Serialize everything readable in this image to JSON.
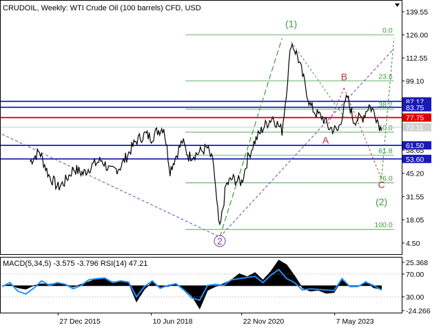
{
  "header": {
    "symbol_line": "CRUDOIL, Weekly:  WTI Crude Oil (100 barrels) CFD, USD"
  },
  "chart_data": [
    {
      "type": "line",
      "title": "CRUDOIL, Weekly:  WTI Crude Oil (100 barrels) CFD, USD",
      "price_axis": {
        "ticks": [
          "139.55",
          "126.00",
          "112.55",
          "99.10",
          "85.65",
          "72.20",
          "58.65",
          "45.20",
          "31.55",
          "18.05",
          "4.50"
        ],
        "ylim": [
          -2,
          146
        ]
      },
      "time_axis": {
        "ticks": [
          "27 Dec 2015",
          "10 Jun 2018",
          "22 Nov 2020",
          "7 May 2023"
        ]
      },
      "price_series": {
        "name": "",
        "x": [
          "2015-03",
          "2015-06",
          "2015-09",
          "2015-12",
          "2016-02",
          "2016-05",
          "2016-08",
          "2016-11",
          "2017-02",
          "2017-05",
          "2017-08",
          "2017-11",
          "2018-01",
          "2018-04",
          "2018-06",
          "2018-08",
          "2018-10",
          "2018-12",
          "2019-02",
          "2019-04",
          "2019-06",
          "2019-09",
          "2019-12",
          "2020-02",
          "2020-03",
          "2020-04",
          "2020-06",
          "2020-08",
          "2020-11",
          "2021-01",
          "2021-03",
          "2021-06",
          "2021-09",
          "2021-12",
          "2022-01",
          "2022-03",
          "2022-05",
          "2022-07",
          "2022-09",
          "2022-11",
          "2023-01",
          "2023-03",
          "2023-06",
          "2023-09",
          "2023-11",
          "2024-02",
          "2024-04",
          "2024-06",
          "2024-08"
        ],
        "values": [
          52,
          58,
          44,
          37,
          40,
          48,
          45,
          50,
          53,
          46,
          49,
          58,
          64,
          68,
          66,
          70,
          72,
          47,
          56,
          64,
          55,
          57,
          60,
          50,
          28,
          12,
          38,
          42,
          40,
          54,
          63,
          72,
          78,
          70,
          86,
          122,
          114,
          100,
          85,
          80,
          78,
          72,
          70,
          90,
          76,
          78,
          85,
          80,
          70
        ]
      },
      "horizontal_levels": [
        {
          "price": 87.17,
          "label": "87.17",
          "color": "#1a1ab4"
        },
        {
          "price": 83.75,
          "label": "83.75",
          "color": "#1a1ab4"
        },
        {
          "price": 77.75,
          "label": "77.75",
          "color": "#e00000"
        },
        {
          "price": 72.11,
          "label": "72.11",
          "color": "#c8c8c8"
        },
        {
          "price": 61.5,
          "label": "61.50",
          "color": "#1a1ab4"
        },
        {
          "price": 53.6,
          "label": "53.60",
          "color": "#1a1ab4"
        }
      ],
      "fibonacci": {
        "color": "#3c9a3c",
        "levels": [
          {
            "label": "0.0",
            "price": 126.0
          },
          {
            "label": "23.6",
            "price": 99.2
          },
          {
            "label": "38.2",
            "price": 82.6
          },
          {
            "label": "50.0",
            "price": 69.2
          },
          {
            "label": "61.8",
            "price": 55.8
          },
          {
            "label": "76.0",
            "price": 39.6
          },
          {
            "label": "100.0",
            "price": 12.4
          }
        ]
      },
      "wave_labels": [
        {
          "text": "(1)",
          "color": "#3c9a3c"
        },
        {
          "text": "2",
          "color": "#7a3fa0"
        },
        {
          "text": "A",
          "color": "#b03a3a"
        },
        {
          "text": "B",
          "color": "#b03a3a"
        },
        {
          "text": "C",
          "color": "#b03a3a"
        },
        {
          "text": "(2)",
          "color": "#3c9a3c"
        }
      ]
    },
    {
      "type": "line",
      "title": "MACD(5,34,5) -3.575 -3.796 RSI(14) 47.21",
      "indicator_axis": {
        "ticks": [
          "25.368",
          "70.00",
          "30.00",
          "-24.266"
        ]
      },
      "series": [
        {
          "name": "MACD",
          "color": "#000000",
          "values": [
            0,
            1,
            -2,
            -3,
            0,
            2,
            1,
            3,
            1,
            -1,
            1,
            4,
            6,
            7,
            3,
            4,
            2,
            -14,
            -4,
            4,
            -2,
            0,
            1,
            -2,
            -10,
            -20,
            -5,
            0,
            1,
            6,
            10,
            9,
            11,
            6,
            12,
            24,
            18,
            10,
            -3,
            -4,
            -5,
            -6,
            -7,
            6,
            -2,
            0,
            3,
            -1,
            -4
          ]
        },
        {
          "name": "RSI",
          "color": "#1e90ff",
          "values": [
            48,
            55,
            40,
            35,
            45,
            58,
            50,
            55,
            52,
            44,
            50,
            60,
            62,
            63,
            55,
            58,
            56,
            30,
            48,
            58,
            45,
            50,
            53,
            42,
            28,
            24,
            50,
            52,
            50,
            60,
            62,
            64,
            66,
            55,
            68,
            78,
            62,
            55,
            42,
            44,
            43,
            42,
            41,
            62,
            48,
            48,
            56,
            50,
            42
          ]
        }
      ]
    }
  ]
}
